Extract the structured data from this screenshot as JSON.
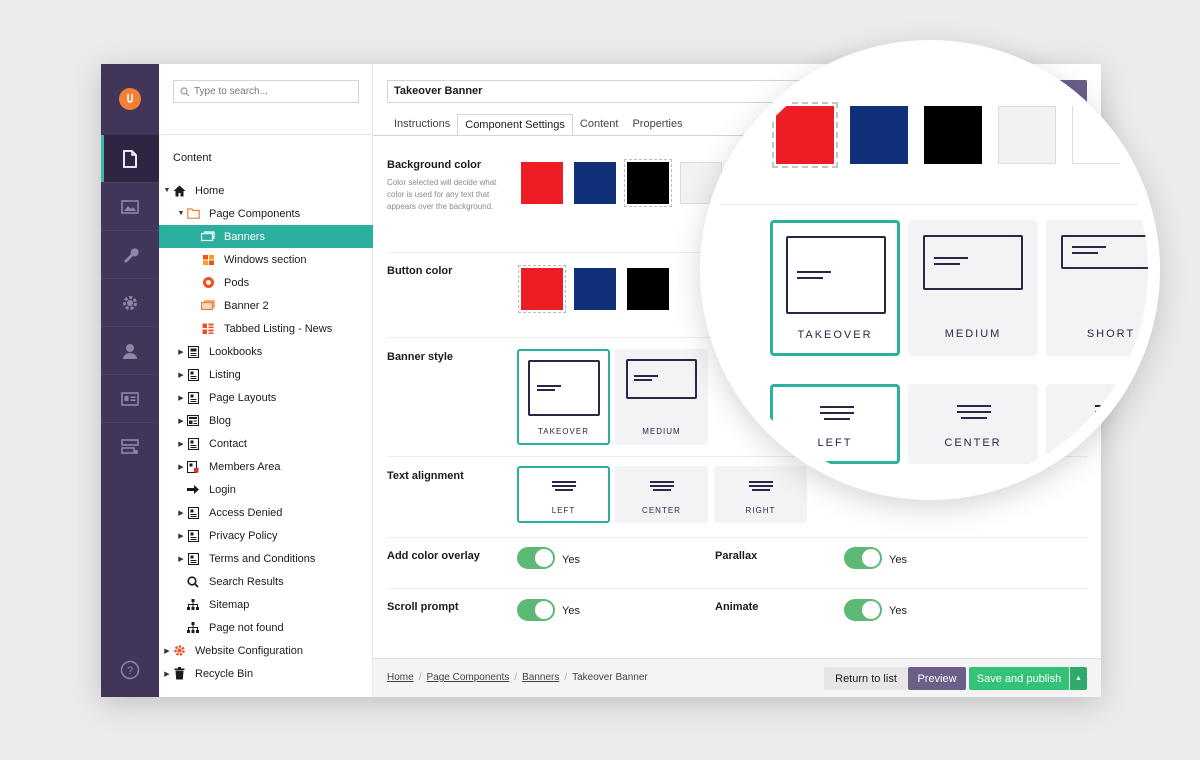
{
  "search": {
    "placeholder": "Type to search..."
  },
  "tree": {
    "title": "Content",
    "nodes": [
      {
        "label": "Home",
        "icon": "home-icon"
      },
      {
        "label": "Page Components",
        "icon": "folder-icon"
      },
      {
        "label": "Banners",
        "icon": "banner-icon"
      },
      {
        "label": "Windows section",
        "icon": "windows-icon"
      },
      {
        "label": "Pods",
        "icon": "pods-icon"
      },
      {
        "label": "Banner 2",
        "icon": "banner-icon"
      },
      {
        "label": "Tabbed Listing - News",
        "icon": "tabbed-listing-icon"
      },
      {
        "label": "Lookbooks",
        "icon": "page-icon"
      },
      {
        "label": "Listing",
        "icon": "page-icon"
      },
      {
        "label": "Page Layouts",
        "icon": "page-icon"
      },
      {
        "label": "Blog",
        "icon": "blog-icon"
      },
      {
        "label": "Contact",
        "icon": "page-icon"
      },
      {
        "label": "Members Area",
        "icon": "page-lock-icon"
      },
      {
        "label": "Login",
        "icon": "arrow-right-icon"
      },
      {
        "label": "Access Denied",
        "icon": "page-icon"
      },
      {
        "label": "Privacy Policy",
        "icon": "page-icon"
      },
      {
        "label": "Terms and Conditions",
        "icon": "page-icon"
      },
      {
        "label": "Search Results",
        "icon": "search-icon"
      },
      {
        "label": "Sitemap",
        "icon": "sitemap-icon"
      },
      {
        "label": "Page not found",
        "icon": "sitemap-icon"
      },
      {
        "label": "Website Configuration",
        "icon": "gear-icon"
      },
      {
        "label": "Recycle Bin",
        "icon": "trash-icon"
      }
    ]
  },
  "editor": {
    "name_value": "Takeover Banner",
    "tabs": [
      {
        "label": "Instructions"
      },
      {
        "label": "Component Settings"
      },
      {
        "label": "Content"
      },
      {
        "label": "Properties"
      }
    ],
    "background_color": {
      "label": "Background color",
      "description": "Color selected will decide what color is used for any text that appears over the background.",
      "swatches": [
        "#ee1c25",
        "#11307a",
        "#000000",
        "#f2f2f2"
      ]
    },
    "button_color": {
      "label": "Button color",
      "swatches": [
        "#ee1c25",
        "#11307a",
        "#000000"
      ]
    },
    "banner_style": {
      "label": "Banner style",
      "options": [
        {
          "label": "TAKEOVER"
        },
        {
          "label": "MEDIUM"
        },
        {
          "label": "SHORT"
        }
      ],
      "selected": "TAKEOVER"
    },
    "text_alignment": {
      "label": "Text alignment",
      "options": [
        {
          "label": "LEFT"
        },
        {
          "label": "CENTER"
        },
        {
          "label": "RIGHT"
        }
      ],
      "selected": "LEFT"
    },
    "toggles": [
      {
        "label": "Add color overlay",
        "value": "Yes"
      },
      {
        "label": "Parallax",
        "value": "Yes"
      },
      {
        "label": "Scroll prompt",
        "value": "Yes"
      },
      {
        "label": "Animate",
        "value": "Yes"
      }
    ]
  },
  "footer": {
    "breadcrumbs": [
      "Home",
      "Page Components",
      "Banners",
      "Takeover Banner"
    ],
    "return_label": "Return to list",
    "preview_label": "Preview",
    "publish_label": "Save and publish"
  },
  "colors": {
    "rail": "#413659",
    "accent": "#2bb0a0",
    "publish": "#34c27a",
    "preview": "#6b5f8a",
    "toggle_on": "#5cba74"
  }
}
